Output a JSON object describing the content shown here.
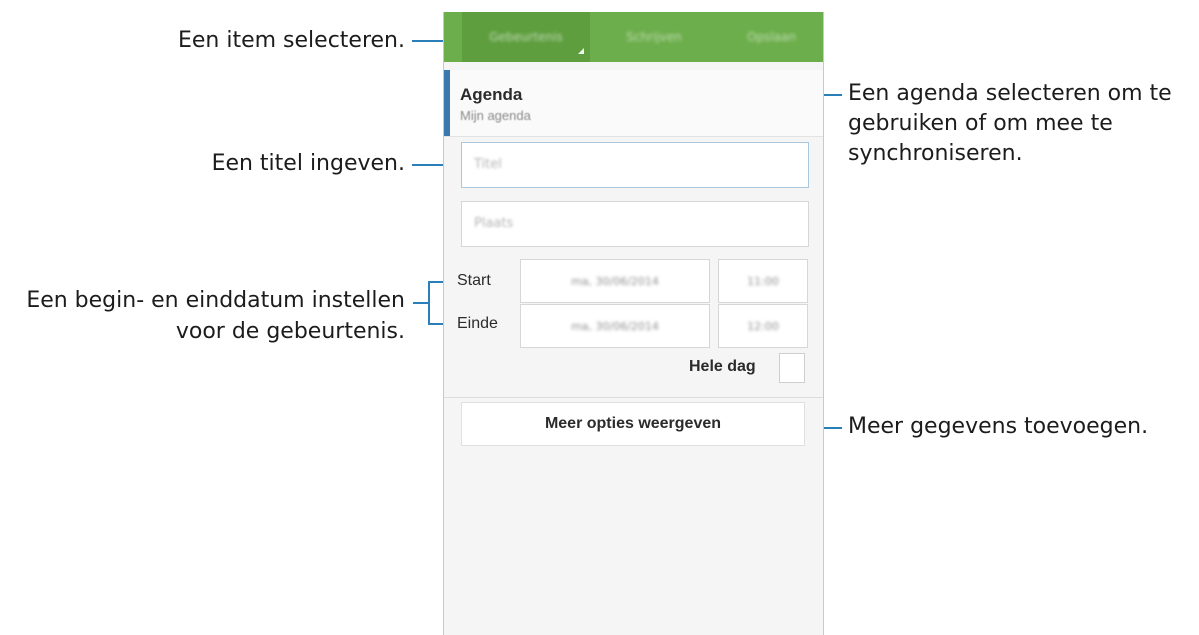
{
  "callouts": {
    "select_item": "Een item selecteren.",
    "enter_title": "Een titel ingeven.",
    "set_dates_line1": "Een begin- en einddatum instellen",
    "set_dates_line2": "voor de gebeurtenis.",
    "select_calendar_line1": "Een agenda selecteren om te",
    "select_calendar_line2": "gebruiken of om mee te",
    "select_calendar_line3": "synchroniseren.",
    "add_details": "Meer gegevens toevoegen."
  },
  "tabs": [
    {
      "label": "Gebeurtenis"
    },
    {
      "label": "Schrijven"
    },
    {
      "label": "Opslaan"
    }
  ],
  "calendar": {
    "title": "Agenda",
    "subtitle": "Mijn agenda"
  },
  "title_field": {
    "placeholder": "Titel"
  },
  "location_field": {
    "placeholder": "Plaats"
  },
  "start": {
    "label": "Start",
    "date": "ma, 30/06/2014",
    "time": "11:00"
  },
  "end": {
    "label": "Einde",
    "date": "ma, 30/06/2014",
    "time": "12:00"
  },
  "all_day": {
    "label": "Hele dag"
  },
  "more_options": {
    "label": "Meer opties weergeven"
  },
  "colors": {
    "tabbar": "#6dae4c",
    "accent": "#3a78ad",
    "callout_line": "#2a7fb8"
  }
}
